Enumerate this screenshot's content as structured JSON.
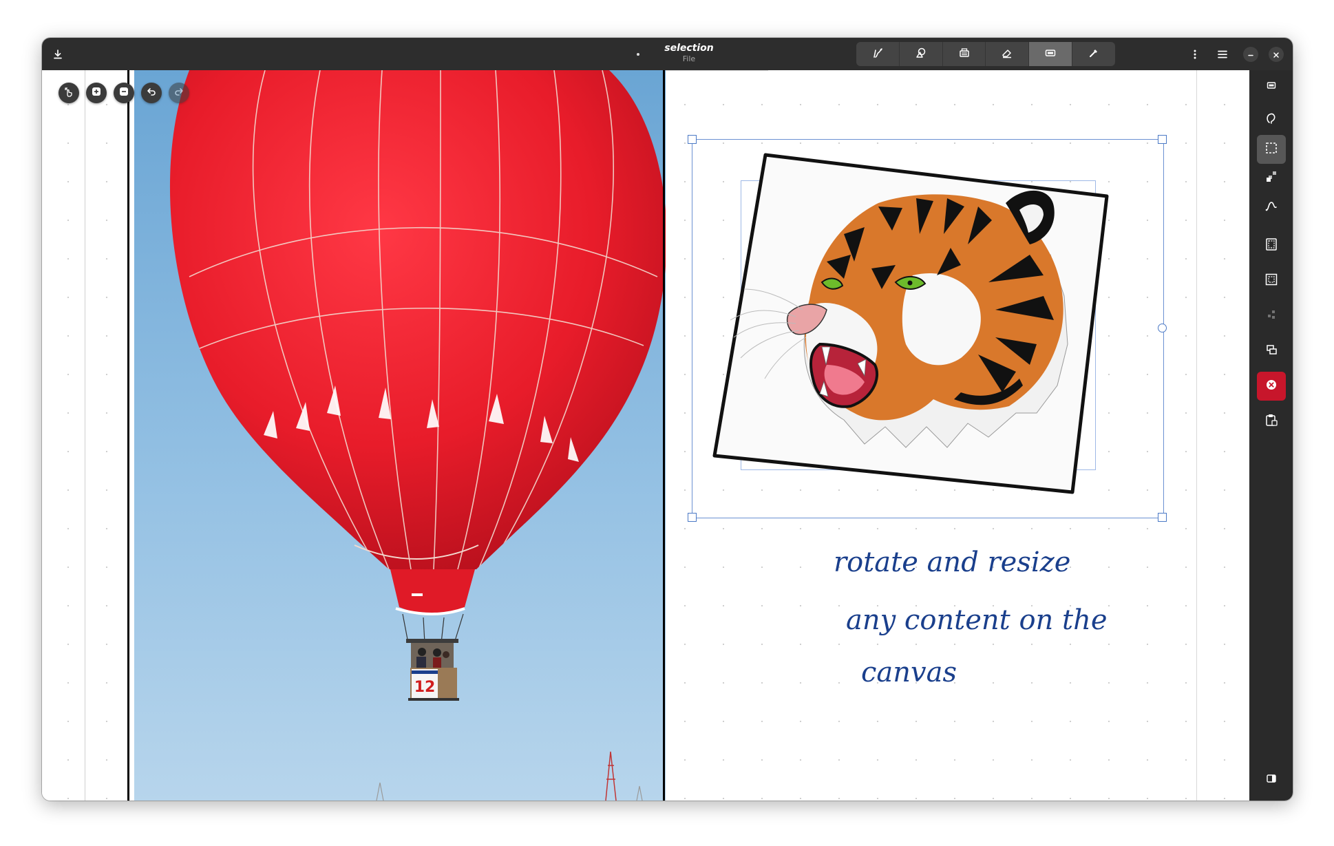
{
  "window": {
    "title": "selection",
    "subtitle": "File"
  },
  "titlebar": {
    "left_icon": "download-icon",
    "pen_styles": [
      {
        "name": "brush-icon",
        "active": false
      },
      {
        "name": "shaper-icon",
        "active": false
      },
      {
        "name": "typewriter-icon",
        "active": false
      },
      {
        "name": "eraser-icon",
        "active": false
      },
      {
        "name": "selector-icon",
        "active": true
      },
      {
        "name": "tools-icon",
        "active": false
      }
    ],
    "right_icons": [
      "more-vertical-icon",
      "hamburger-menu-icon",
      "minimize-icon",
      "close-icon"
    ]
  },
  "canvas_toolbar": [
    "hand-touch-icon",
    "zoom-in-icon",
    "zoom-out-icon",
    "undo-icon",
    "redo-icon"
  ],
  "sidebar": {
    "items": [
      {
        "name": "selector-mode-icon",
        "state": "normal"
      },
      {
        "name": "lasso-select-icon",
        "state": "normal"
      },
      {
        "name": "rectangle-select-icon",
        "state": "active"
      },
      {
        "name": "single-select-icon",
        "state": "normal"
      },
      {
        "name": "intersecting-path-select-icon",
        "state": "normal"
      },
      {
        "name": "select-all-on-page-icon",
        "state": "normal"
      },
      {
        "name": "select-all-icon",
        "state": "normal"
      },
      {
        "name": "deselect-icon",
        "state": "dim"
      },
      {
        "name": "duplicate-icon",
        "state": "normal"
      },
      {
        "name": "delete-selection-icon",
        "state": "danger"
      },
      {
        "name": "paste-icon",
        "state": "normal"
      },
      {
        "name": "sidebar-toggle-icon",
        "state": "normal"
      }
    ]
  },
  "canvas": {
    "balloon_number": "12",
    "handwriting": [
      "rotate and resize",
      "any content on the",
      "canvas"
    ]
  },
  "colors": {
    "titlebar": "#2d2d2d",
    "sidebar": "#2a2a2a",
    "danger": "#c7162b",
    "selection": "#4a78c5",
    "ink": "#1a3f8c",
    "balloon_red": "#e81e2c",
    "sky": "#7db1d9"
  }
}
